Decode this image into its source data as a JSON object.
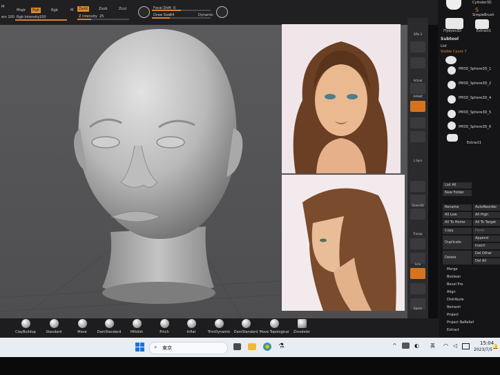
{
  "toolbar": {
    "mrgb": "Mrgb",
    "rgb": "Rgb",
    "m": "M",
    "rgb2": "Rgb",
    "zadd": "Zadd",
    "zsub": "Zsub",
    "zcut": "Zcut",
    "rgb_intensity": "Rgb Intensity",
    "rgb_intensity_value": "100",
    "z_intensity": "Z Intensity",
    "z_intensity_value": "25",
    "focal_shift": "Focal Shift",
    "focal_shift_value": "0",
    "draw_size": "Draw Size",
    "draw_size_value": "64",
    "dynamic": "Dynamic",
    "left_label": "ers 100"
  },
  "rightstrip": {
    "items": [
      "SPix 3",
      "Persp",
      "Actual",
      "AAHalf",
      "Frame",
      "Move",
      "Zoom3D",
      "Rotate",
      "Transp",
      "LSym",
      "Line Fill",
      "PolyF",
      "Solo",
      "Xpose"
    ],
    "spix": "SPix 3",
    "actual": "Actual",
    "aahalf": "AAHalf",
    "xyz": "L.Sym",
    "zoom3d": "Zoom3D",
    "rotate": "Rotate",
    "transp": "Transp",
    "line": "Line",
    "xpose": "Xpose",
    "move_lbl": "Move",
    "ghost": "Ghost"
  },
  "rightpanel": {
    "cylinder": "Cylinder3D",
    "simplebrush": "SimpleBrush",
    "flyeye": "Flyeyes3D",
    "extract1": "Extract1",
    "subtool_title": "Subtool",
    "list_label": "List",
    "visible_count": "Visible Count 7",
    "subtools": [
      "PM3D_Sphere3D_1",
      "PM3D_Sphere3D_2",
      "PM3D_Sphere3D_4",
      "PM3D_Sphere3D_5",
      "PM3D_Sphere3D_6",
      "Extract1"
    ],
    "list_all": "List All",
    "new_folder": "New Folder",
    "rename": "Rename",
    "auto_reorder": "AutoReorder",
    "all_low": "All Low",
    "all_high": "All High",
    "all_to_home": "All To Home",
    "all_to_target": "All To Target",
    "copy": "Copy",
    "paste": "Paste",
    "duplicate": "Duplicate",
    "append": "Append",
    "insert": "Insert",
    "delete": "Delete",
    "del_other": "Del Other",
    "del_all": "Del All",
    "menu": [
      "Merge",
      "Boolean",
      "Bevel Pro",
      "Align",
      "Distribute",
      "Remesh",
      "Project",
      "Project BaRelief",
      "Extract"
    ]
  },
  "brushes": [
    "ClayBuildup",
    "Standard",
    "Move",
    "DamStandard",
    "HPolish",
    "Pinch",
    "Inflat",
    "TrimDynamic",
    "DamStandard",
    "Move Topological",
    "Zmodeler"
  ],
  "taskbar": {
    "search_text": "東京",
    "time": "15:04",
    "date": "2023/7/5",
    "ime": "英"
  },
  "colors": {
    "accent": "#e08a2a",
    "panel": "#151517",
    "viewport": "#555557"
  }
}
